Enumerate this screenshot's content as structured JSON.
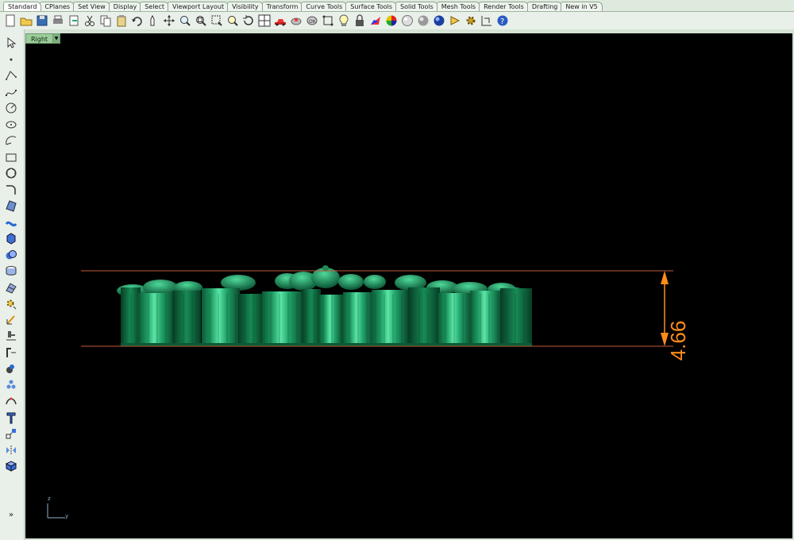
{
  "tabs": [
    "Standard",
    "CPlanes",
    "Set View",
    "Display",
    "Select",
    "Viewport Layout",
    "Visibility",
    "Transform",
    "Curve Tools",
    "Surface Tools",
    "Solid Tools",
    "Mesh Tools",
    "Render Tools",
    "Drafting",
    "New in V5"
  ],
  "active_tab": "Standard",
  "viewport": {
    "name": "Right",
    "dimension_value": "4.66"
  },
  "axis": {
    "z": "z",
    "y": "y"
  },
  "more_glyph": "»",
  "toolbar_icons": [
    "new-file-icon",
    "open-file-icon",
    "save-icon",
    "print-icon",
    "import-icon",
    "cut-icon",
    "copy-icon",
    "paste-icon",
    "undo-icon",
    "pan-icon",
    "move-view-icon",
    "zoom-icon",
    "zoom-window-icon",
    "zoom-extents-icon",
    "zoom-selected-icon",
    "rotate-view-icon",
    "four-viewports-icon",
    "car-icon",
    "grid-snap-icon",
    "osnap-icon",
    "select-points-icon",
    "light-bulb-icon",
    "lock-icon",
    "color-icon",
    "render-sphere-icon",
    "material-sphere-icon",
    "shaded-sphere-icon",
    "blue-sphere-icon",
    "render-options-icon",
    "settings-gear-icon",
    "dimension-icon",
    "help-icon"
  ],
  "colors": {
    "object": "#1f8f5c",
    "dimension": "#ff8c1a",
    "guide": "#c05a3a"
  }
}
